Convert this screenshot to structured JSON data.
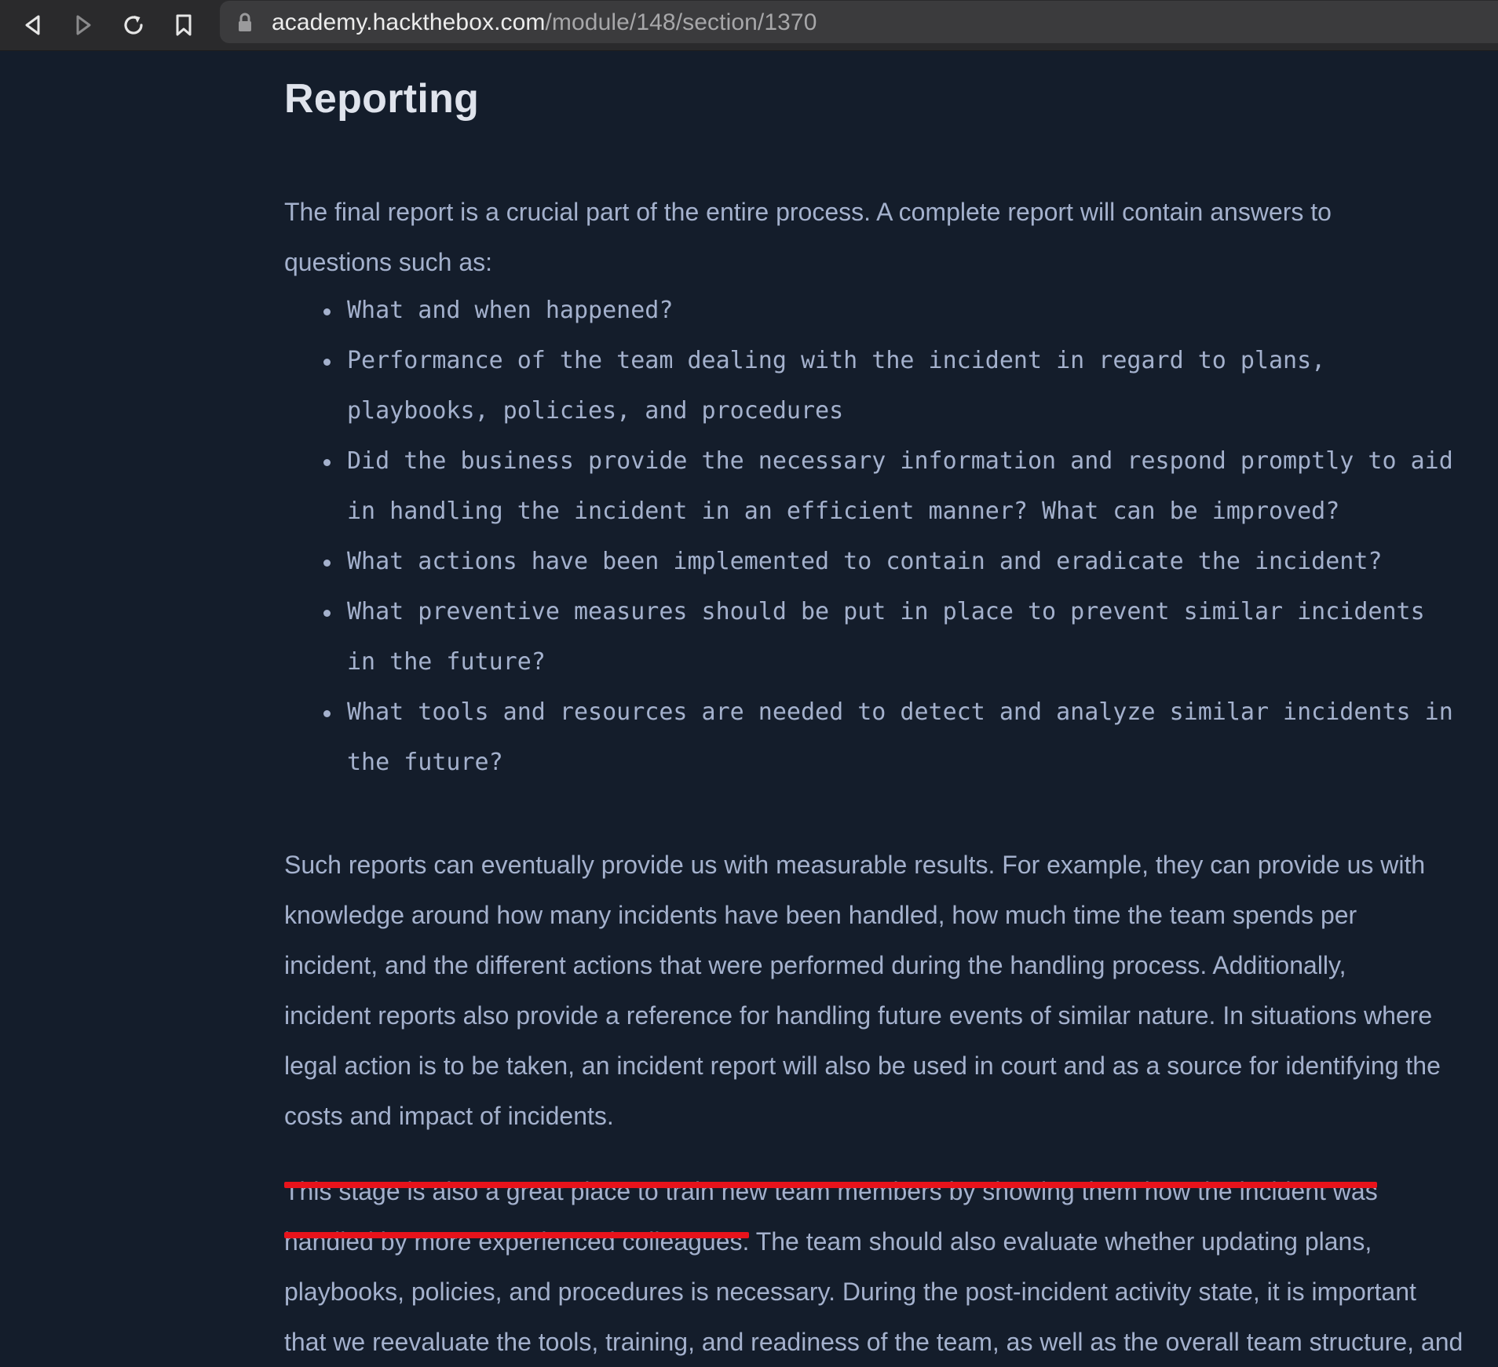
{
  "browser": {
    "url_domain": "academy.hackthebox.com",
    "url_path": "/module/148/section/1370"
  },
  "article": {
    "title": "Reporting",
    "intro_lines": [
      "The final report is a crucial part of the entire process. A complete report will contain answers to",
      "questions such as:"
    ],
    "bullets": [
      {
        "lines": [
          "What and when happened?"
        ]
      },
      {
        "lines": [
          "Performance of the team dealing with the incident in regard to plans,",
          "playbooks, policies, and procedures"
        ]
      },
      {
        "lines": [
          "Did the business provide the necessary information and respond promptly to aid",
          "in handling the incident in an efficient manner? What can be improved?"
        ]
      },
      {
        "lines": [
          "What actions have been implemented to contain and eradicate the incident?"
        ]
      },
      {
        "lines": [
          "What preventive measures should be put in place to prevent similar incidents",
          "in the future?"
        ]
      },
      {
        "lines": [
          "What tools and resources are needed to detect and analyze similar incidents in",
          "the future?"
        ]
      }
    ],
    "body_lines": [
      "Such reports can eventually provide us with measurable results. For example, they can provide us with",
      "knowledge around how many incidents have been handled, how much time the team spends per",
      "incident, and the different actions that were performed during the handling process. Additionally,",
      "incident reports also provide a reference for handling future events of similar nature. In situations where",
      "legal action is to be taken, an incident report will also be used in court and as a source for identifying the",
      "costs and impact of incidents."
    ],
    "final_lines": [
      "This stage is also a great place to train new team members by showing them how the incident was",
      "handled by more experienced colleagues. The team should also evaluate whether updating plans,",
      "playbooks, policies, and procedures is necessary. During the post-incident activity state, it is important",
      "that we reevaluate the tools, training, and readiness of the team, as well as the overall team structure, and"
    ]
  },
  "colors": {
    "page_background": "#141d2b",
    "title": "#dfe3ec",
    "text": "#a4b1cd",
    "highlight_underline": "#e8131b"
  },
  "icons": [
    "back-icon",
    "forward-icon",
    "reload-icon",
    "bookmark-icon",
    "lock-icon"
  ]
}
